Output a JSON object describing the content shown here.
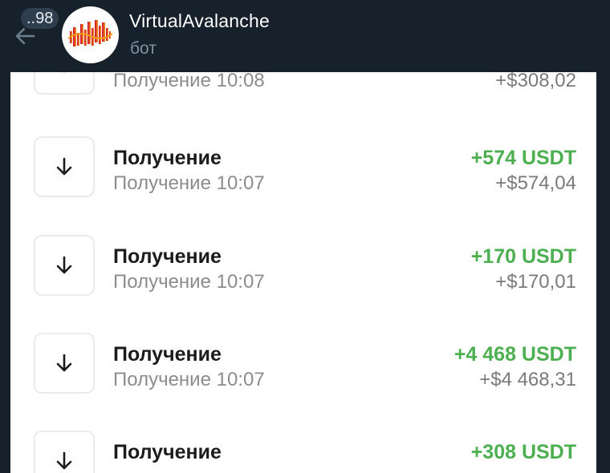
{
  "header": {
    "unread_count": "..98",
    "title": "VirtualAvalanche",
    "subtitle": "бот",
    "back_icon": "arrow-left-icon",
    "avatar_icon": "avalanche-logo"
  },
  "colors": {
    "header_bg": "#17212b",
    "positive_amount": "#4caf50",
    "secondary_text": "#8c8c8c"
  },
  "transactions": [
    {
      "icon": "arrow-down-icon",
      "title": "",
      "subtitle": "Получение 10:08",
      "amount": "",
      "fiat": "+$308,02"
    },
    {
      "icon": "arrow-down-icon",
      "title": "Получение",
      "subtitle": "Получение 10:07",
      "amount": "+574 USDT",
      "fiat": "+$574,04"
    },
    {
      "icon": "arrow-down-icon",
      "title": "Получение",
      "subtitle": "Получение 10:07",
      "amount": "+170 USDT",
      "fiat": "+$170,01"
    },
    {
      "icon": "arrow-down-icon",
      "title": "Получение",
      "subtitle": "Получение 10:07",
      "amount": "+4 468 USDT",
      "fiat": "+$4 468,31"
    },
    {
      "icon": "arrow-down-icon",
      "title": "Получение",
      "subtitle": "",
      "amount": "+308 USDT",
      "fiat": ""
    }
  ]
}
